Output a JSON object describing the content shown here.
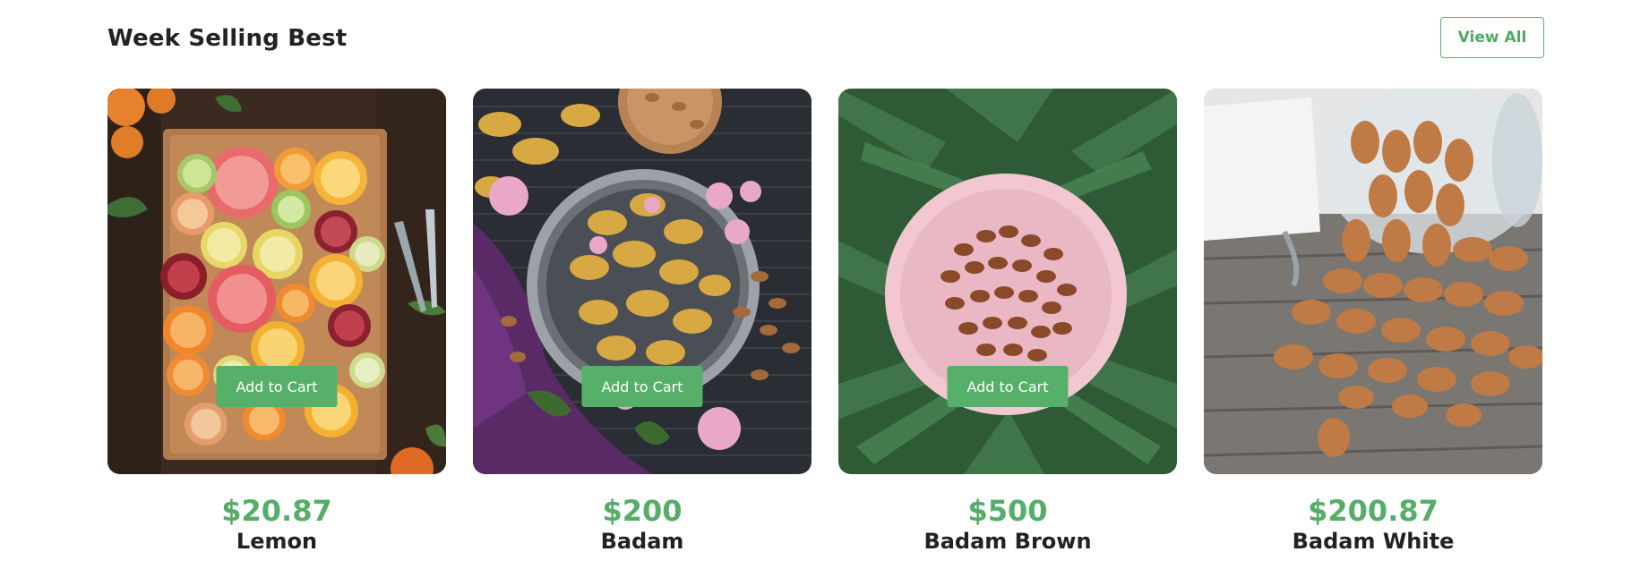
{
  "section": {
    "title": "Week Selling Best",
    "view_all_label": "View All"
  },
  "products": [
    {
      "image": "citrus-slices-board-image",
      "price": "$20.87",
      "name": "Lemon",
      "cta": "Add to Cart"
    },
    {
      "image": "badam-bowl-image",
      "price": "$200",
      "name": "Badam",
      "cta": "Add to Cart"
    },
    {
      "image": "almonds-pink-plate-image",
      "price": "$500",
      "name": "Badam Brown",
      "cta": "Add to Cart"
    },
    {
      "image": "almonds-spilled-jar-image",
      "price": "$200.87",
      "name": "Badam White",
      "cta": null
    }
  ],
  "colors": {
    "accent": "#56b06a",
    "text": "#222222"
  }
}
